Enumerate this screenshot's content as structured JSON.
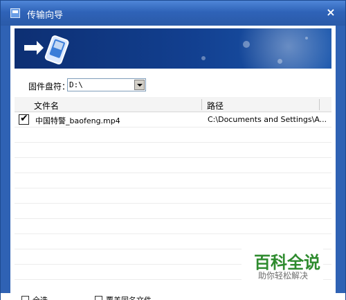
{
  "window": {
    "title": "传输向导",
    "close_glyph": "×",
    "icon": "app-window-icon"
  },
  "drive": {
    "label": "固件盘符：",
    "value": "D:\\"
  },
  "table": {
    "headers": [
      "文件名",
      "路径"
    ],
    "rows": [
      {
        "checked": true,
        "name": "中国特警_baofeng.mp4",
        "path": "C:\\Documents and Settings\\A..."
      }
    ]
  },
  "footer": {
    "select_all": "全选",
    "overwrite": "覆盖同名文件"
  },
  "watermark": {
    "main": "百科全说",
    "sub": "助你轻松解决"
  }
}
